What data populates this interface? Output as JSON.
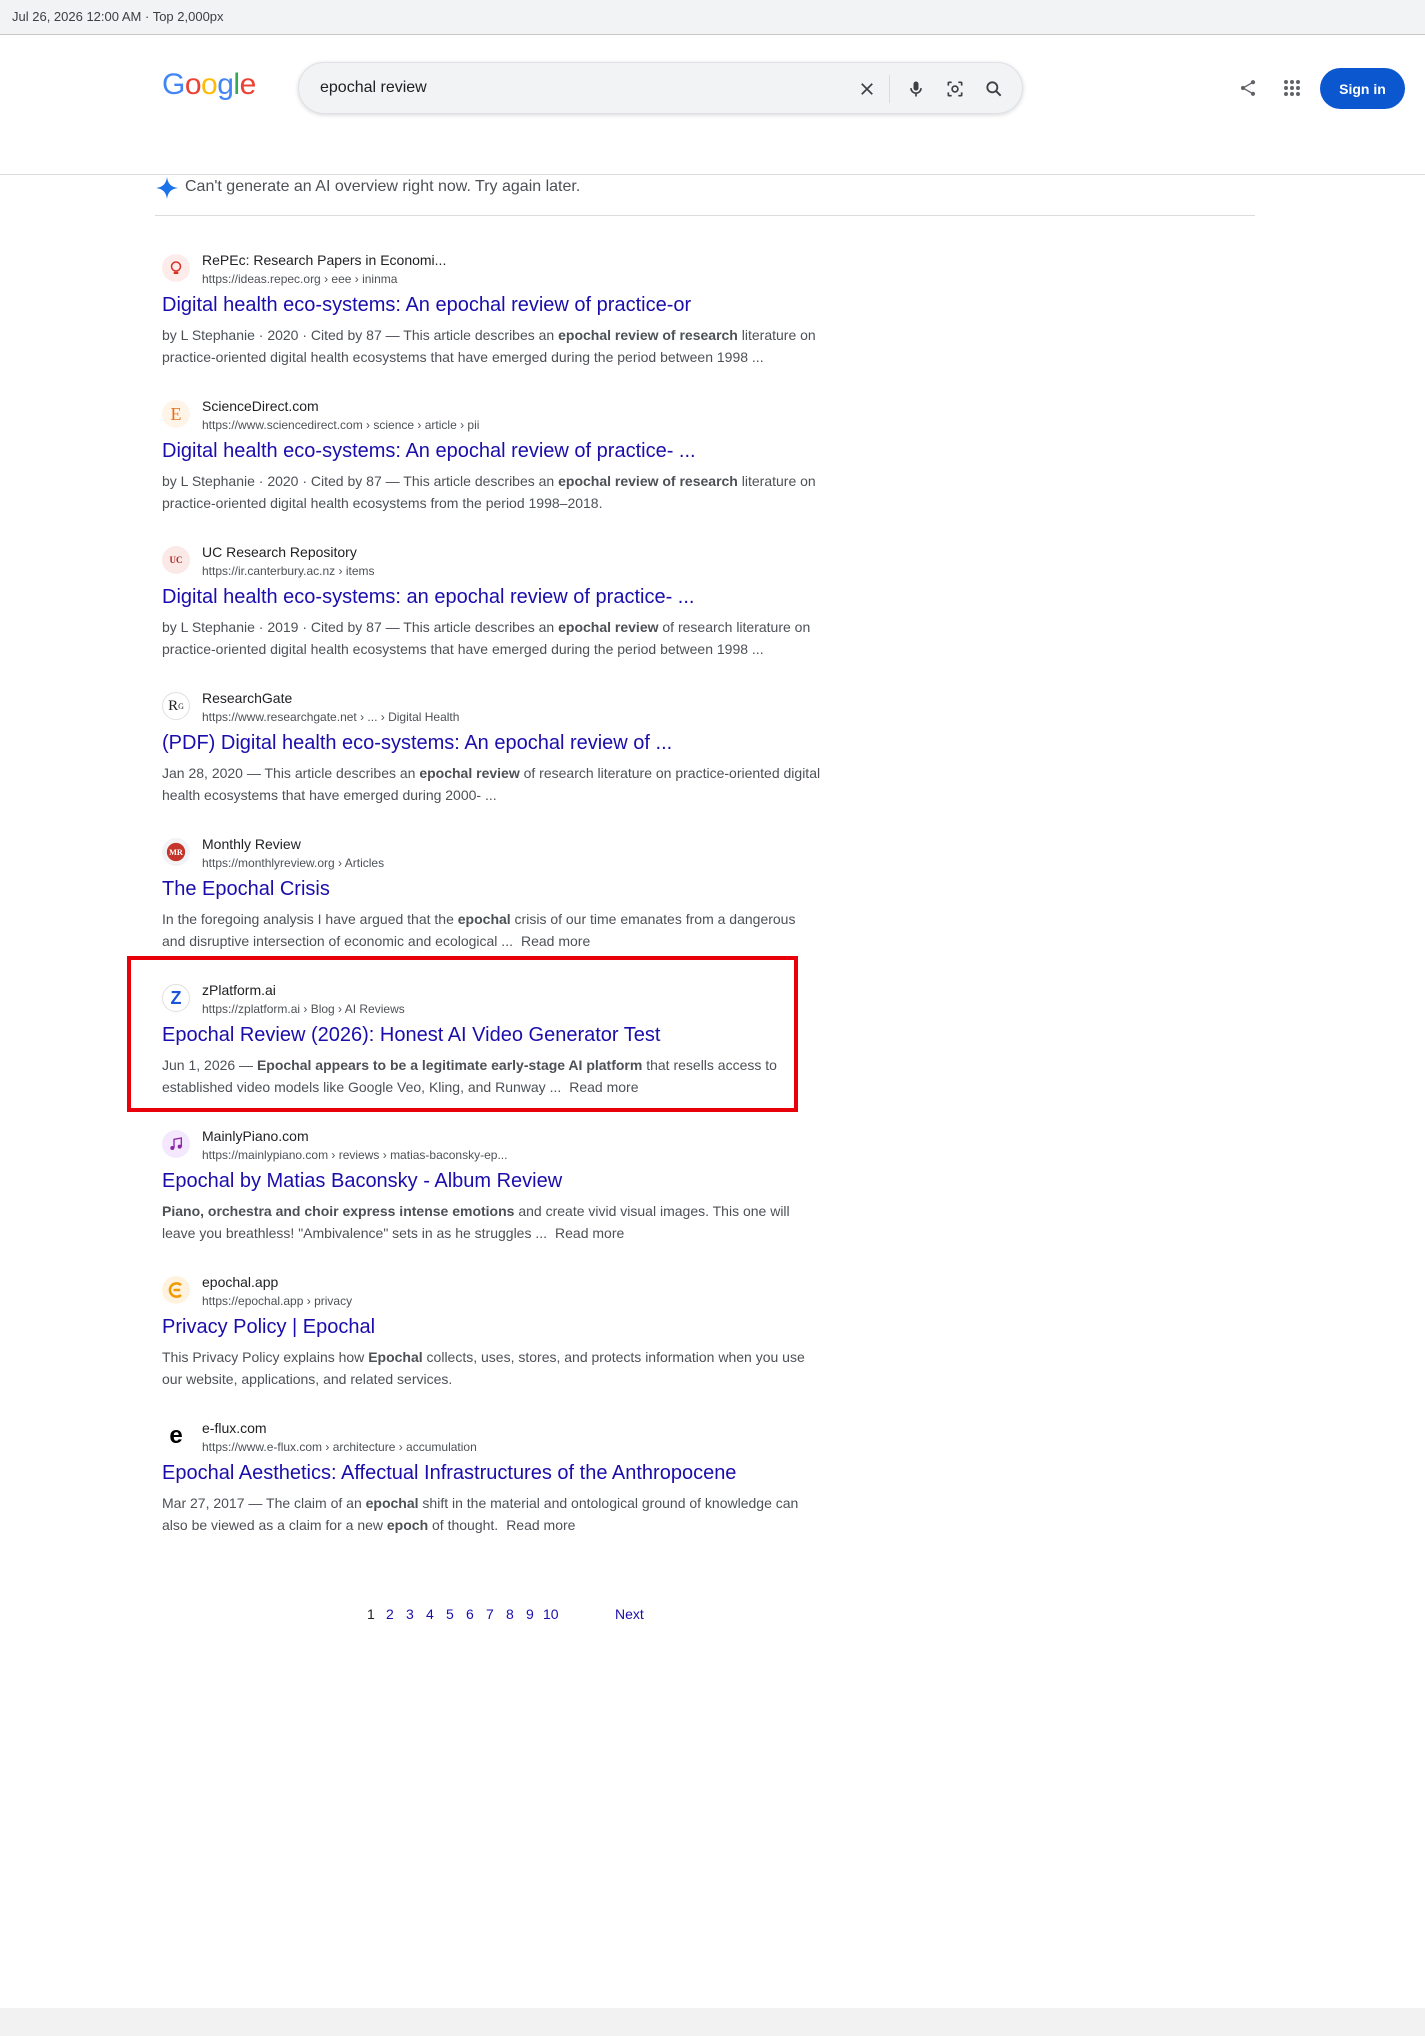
{
  "capture_bar": {
    "text": "Jul 26, 2026 12:00 AM · Top 2,000px"
  },
  "header": {
    "logo": {
      "letters": [
        "G",
        "o",
        "o",
        "g",
        "l",
        "e"
      ]
    },
    "search": {
      "query": "epochal  review"
    },
    "sign_in_label": "Sign in"
  },
  "ai_overview": {
    "message": "Can't  generate  an AI overview right now. Try again later."
  },
  "results": [
    {
      "site": "RePEc: Research Papers in Economi...",
      "url": "https://ideas.repec.org › eee › ininma",
      "title": "Digital health eco‑systems: An epochal review of practice‑or",
      "snippet_parts": [
        {
          "t": "by L Stephanie · 2020 · Cited by 87 — This article describes an "
        },
        {
          "t": "epochal review of research",
          "b": true
        },
        {
          "t": " literature on practice-oriented digital health ecosystems that have emerged during the period between 1998 ..."
        }
      ],
      "favicon": "bulb-icon",
      "read_more": ""
    },
    {
      "site": "ScienceDirect.com",
      "url": "https://www.sciencedirect.com › science › article › pii",
      "title": "Digital health eco‑systems: An epochal review of practice‑ ...",
      "snippet_parts": [
        {
          "t": "by L Stephanie · 2020 · Cited by 87 — This article describes an "
        },
        {
          "t": "epochal review of research",
          "b": true
        },
        {
          "t": " literature on practice-oriented digital health ecosystems from the period 1998–2018."
        }
      ],
      "favicon": "elsevier-icon",
      "read_more": ""
    },
    {
      "site": "UC Research Repository",
      "url": "https://ir.canterbury.ac.nz › items",
      "title": "Digital health eco‑systems: an epochal review of practice‑ ...",
      "snippet_parts": [
        {
          "t": "by L Stephanie · 2019 · Cited by 87 — This article describes an "
        },
        {
          "t": "epochal review",
          "b": true
        },
        {
          "t": " of research literature on practice-oriented digital health ecosystems that have emerged during the period between 1998 ..."
        }
      ],
      "favicon": "uc-crest-icon",
      "read_more": ""
    },
    {
      "site": "ResearchGate",
      "url": "https://www.researchgate.net › ... › Digital Health",
      "title": "(PDF) Digital health eco‑systems: An epochal review of ...",
      "snippet_parts": [
        {
          "t": "Jan 28, 2020 — This article describes an "
        },
        {
          "t": "epochal review",
          "b": true
        },
        {
          "t": " of research literature on practice-oriented digital health ecosystems that have emerged during 2000- ..."
        }
      ],
      "favicon": "researchgate-icon",
      "read_more": ""
    },
    {
      "site": "Monthly Review",
      "url": "https://monthlyreview.org › Articles",
      "title": "The Epochal Crisis",
      "snippet_parts": [
        {
          "t": "In the foregoing analysis I have argued that the "
        },
        {
          "t": "epochal",
          "b": true
        },
        {
          "t": " crisis of our time emanates from a dangerous and disruptive intersection of economic and ecological ..."
        }
      ],
      "favicon": "monthly-review-icon",
      "read_more": "Read more"
    },
    {
      "site": "zPlatform.ai",
      "url": "https://zplatform.ai › Blog › AI Reviews",
      "title": "Epochal Review (2026): Honest AI Video Generator  Test",
      "snippet_parts": [
        {
          "t": "Jun 1, 2026 — "
        },
        {
          "t": "Epochal appears to be a legitimate early-stage AI platform",
          "b": true
        },
        {
          "t": " that resells access to established video models like Google Veo, Kling, and Runway ..."
        }
      ],
      "favicon": "zplatform-icon",
      "read_more": "Read more"
    },
    {
      "site": "MainlyPiano.com",
      "url": "https://mainlypiano.com › reviews › matias-baconsky-ep...",
      "title": "Epochal by Matias Baconsky - Album Review",
      "snippet_parts": [
        {
          "t": "Piano, orchestra and choir express intense emotions",
          "b": true
        },
        {
          "t": " and create vivid visual images. This one will leave you breathless! \"Ambivalence\" sets in as he struggles ..."
        }
      ],
      "favicon": "music-note-icon",
      "read_more": "Read more"
    },
    {
      "site": "epochal.app",
      "url": "https://epochal.app › privacy",
      "title": "Privacy Policy | Epochal",
      "snippet_parts": [
        {
          "t": "This Privacy Policy explains how "
        },
        {
          "t": "Epochal",
          "b": true
        },
        {
          "t": " collects, uses, stores, and protects information when you use our website, applications, and related services."
        }
      ],
      "favicon": "epochal-logo-icon",
      "read_more": ""
    },
    {
      "site": "e-flux.com",
      "url": "https://www.e-flux.com › architecture › accumulation",
      "title": "Epochal Aesthetics: Affectual Infrastructures  of the Anthropocene",
      "snippet_parts": [
        {
          "t": "Mar 27, 2017 — The claim of an "
        },
        {
          "t": "epochal",
          "b": true
        },
        {
          "t": " shift in the material and ontological ground of knowledge can also be viewed as a claim for a new "
        },
        {
          "t": "epoch",
          "b": true
        },
        {
          "t": " of thought."
        }
      ],
      "favicon": "eflux-icon",
      "read_more": "Read more"
    }
  ],
  "pagination": {
    "pages": [
      "1",
      "2",
      "3",
      "4",
      "5",
      "6",
      "7",
      "8",
      "9",
      "10"
    ],
    "current": "1",
    "next_label": "Next"
  },
  "colors": {
    "link": "#1a0dab",
    "snippet": "#4d5156",
    "signin_bg": "#0b57d0",
    "highlight_border": "#e8000b"
  }
}
